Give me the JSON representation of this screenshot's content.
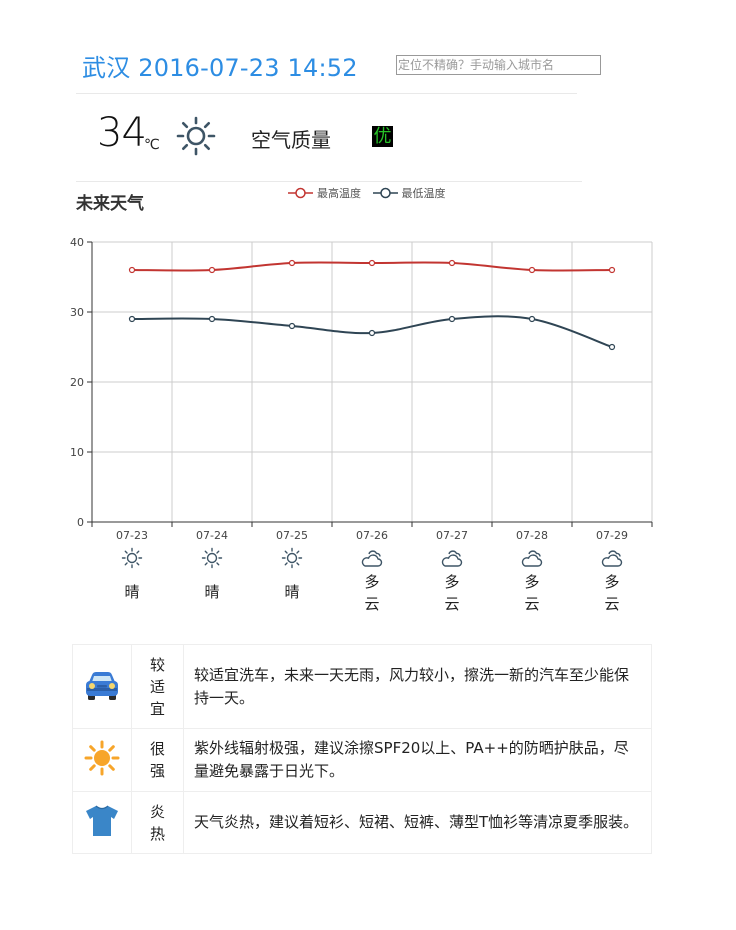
{
  "header": {
    "title": "武汉 2016-07-23 14:52",
    "city_input_placeholder": "定位不精确？手动输入城市名"
  },
  "current": {
    "temperature": "34",
    "unit": "℃",
    "icon": "sun-icon",
    "air_quality_label": "空气质量",
    "air_quality_value": "优"
  },
  "forecast": {
    "section_title": "未来天气",
    "days": [
      {
        "date": "07-23",
        "icon": "sun-icon",
        "desc": "晴"
      },
      {
        "date": "07-24",
        "icon": "sun-icon",
        "desc": "晴"
      },
      {
        "date": "07-25",
        "icon": "sun-icon",
        "desc": "晴"
      },
      {
        "date": "07-26",
        "icon": "cloud-icon",
        "desc": "多云"
      },
      {
        "date": "07-27",
        "icon": "cloud-icon",
        "desc": "多云"
      },
      {
        "date": "07-28",
        "icon": "cloud-icon",
        "desc": "多云"
      },
      {
        "date": "07-29",
        "icon": "cloud-icon",
        "desc": "多云"
      }
    ]
  },
  "chart_data": {
    "type": "line",
    "categories": [
      "07-23",
      "07-24",
      "07-25",
      "07-26",
      "07-27",
      "07-28",
      "07-29"
    ],
    "series": [
      {
        "name": "最高温度",
        "values": [
          36,
          36,
          37,
          37,
          37,
          36,
          36
        ],
        "color": "#c23531"
      },
      {
        "name": "最低温度",
        "values": [
          29,
          29,
          28,
          27,
          29,
          29,
          25
        ],
        "color": "#2f4554"
      }
    ],
    "ylim": [
      0,
      40
    ],
    "yticks": [
      0,
      10,
      20,
      30,
      40
    ],
    "grid": true,
    "legend_position": "top-center"
  },
  "tips": [
    {
      "icon": "car-icon",
      "level": "较适宜",
      "text": "较适宜洗车，未来一天无雨，风力较小，擦洗一新的汽车至少能保持一天。"
    },
    {
      "icon": "sun-icon",
      "level": "很强",
      "text": "紫外线辐射极强，建议涂擦SPF20以上、PA++的防晒护肤品，尽量避免暴露于日光下。"
    },
    {
      "icon": "tshirt-icon",
      "level": "炎热",
      "text": "天气炎热，建议着短衫、短裙、短裤、薄型T恤衫等清凉夏季服装。"
    }
  ]
}
